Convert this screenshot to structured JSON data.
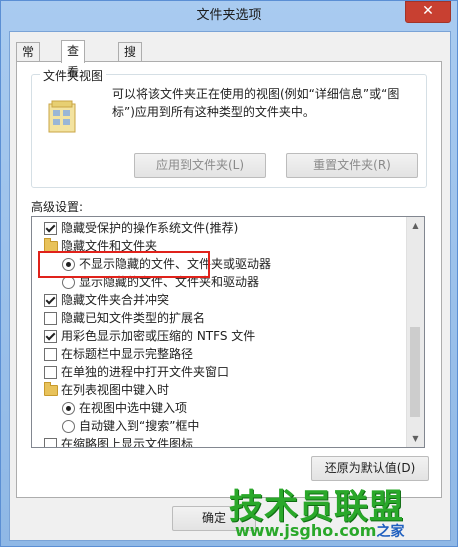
{
  "window": {
    "title": "文件夹选项",
    "close_glyph": "✕"
  },
  "tabs": [
    {
      "label": "常规",
      "active": false
    },
    {
      "label": "查看",
      "active": true
    },
    {
      "label": "搜索",
      "active": false
    }
  ],
  "folder_views": {
    "title": "文件夹视图",
    "description": "可以将该文件夹正在使用的视图(例如“详细信息”或“图标”)应用到所有这种类型的文件夹中。",
    "apply_button": "应用到文件夹(L)",
    "reset_button": "重置文件夹(R)",
    "icon": "folder-view-icon"
  },
  "advanced": {
    "label": "高级设置:",
    "rows": [
      {
        "type": "checkbox",
        "checked": true,
        "indent": 1,
        "label": "隐藏受保护的操作系统文件(推荐)"
      },
      {
        "type": "folder",
        "checked": false,
        "indent": 1,
        "label": "隐藏文件和文件夹"
      },
      {
        "type": "radio",
        "checked": true,
        "indent": 2,
        "label": "不显示隐藏的文件、文件夹或驱动器"
      },
      {
        "type": "radio",
        "checked": false,
        "indent": 2,
        "label": "显示隐藏的文件、文件夹和驱动器"
      },
      {
        "type": "checkbox",
        "checked": true,
        "indent": 1,
        "label": "隐藏文件夹合并冲突"
      },
      {
        "type": "checkbox",
        "checked": false,
        "indent": 1,
        "label": "隐藏已知文件类型的扩展名"
      },
      {
        "type": "checkbox",
        "checked": true,
        "indent": 1,
        "label": "用彩色显示加密或压缩的 NTFS 文件"
      },
      {
        "type": "checkbox",
        "checked": false,
        "indent": 1,
        "label": "在标题栏中显示完整路径"
      },
      {
        "type": "checkbox",
        "checked": false,
        "indent": 1,
        "label": "在单独的进程中打开文件夹窗口"
      },
      {
        "type": "folder",
        "checked": false,
        "indent": 1,
        "label": "在列表视图中键入时"
      },
      {
        "type": "radio",
        "checked": true,
        "indent": 2,
        "label": "在视图中选中键入项"
      },
      {
        "type": "radio",
        "checked": false,
        "indent": 2,
        "label": "自动键入到“搜索”框中"
      },
      {
        "type": "checkbox",
        "checked": false,
        "indent": 1,
        "label": "在缩略图上显示文件图标"
      }
    ],
    "restore_button": "还原为默认值(D)"
  },
  "footer": {
    "ok_button": "确定"
  },
  "watermark": {
    "text": "技术员联盟",
    "url": "www.jsgho.com",
    "suffix": "之家"
  },
  "colors": {
    "highlight": "#e0221b",
    "titlebar": "#a9cbf0",
    "watermark": "#2aa82a"
  }
}
